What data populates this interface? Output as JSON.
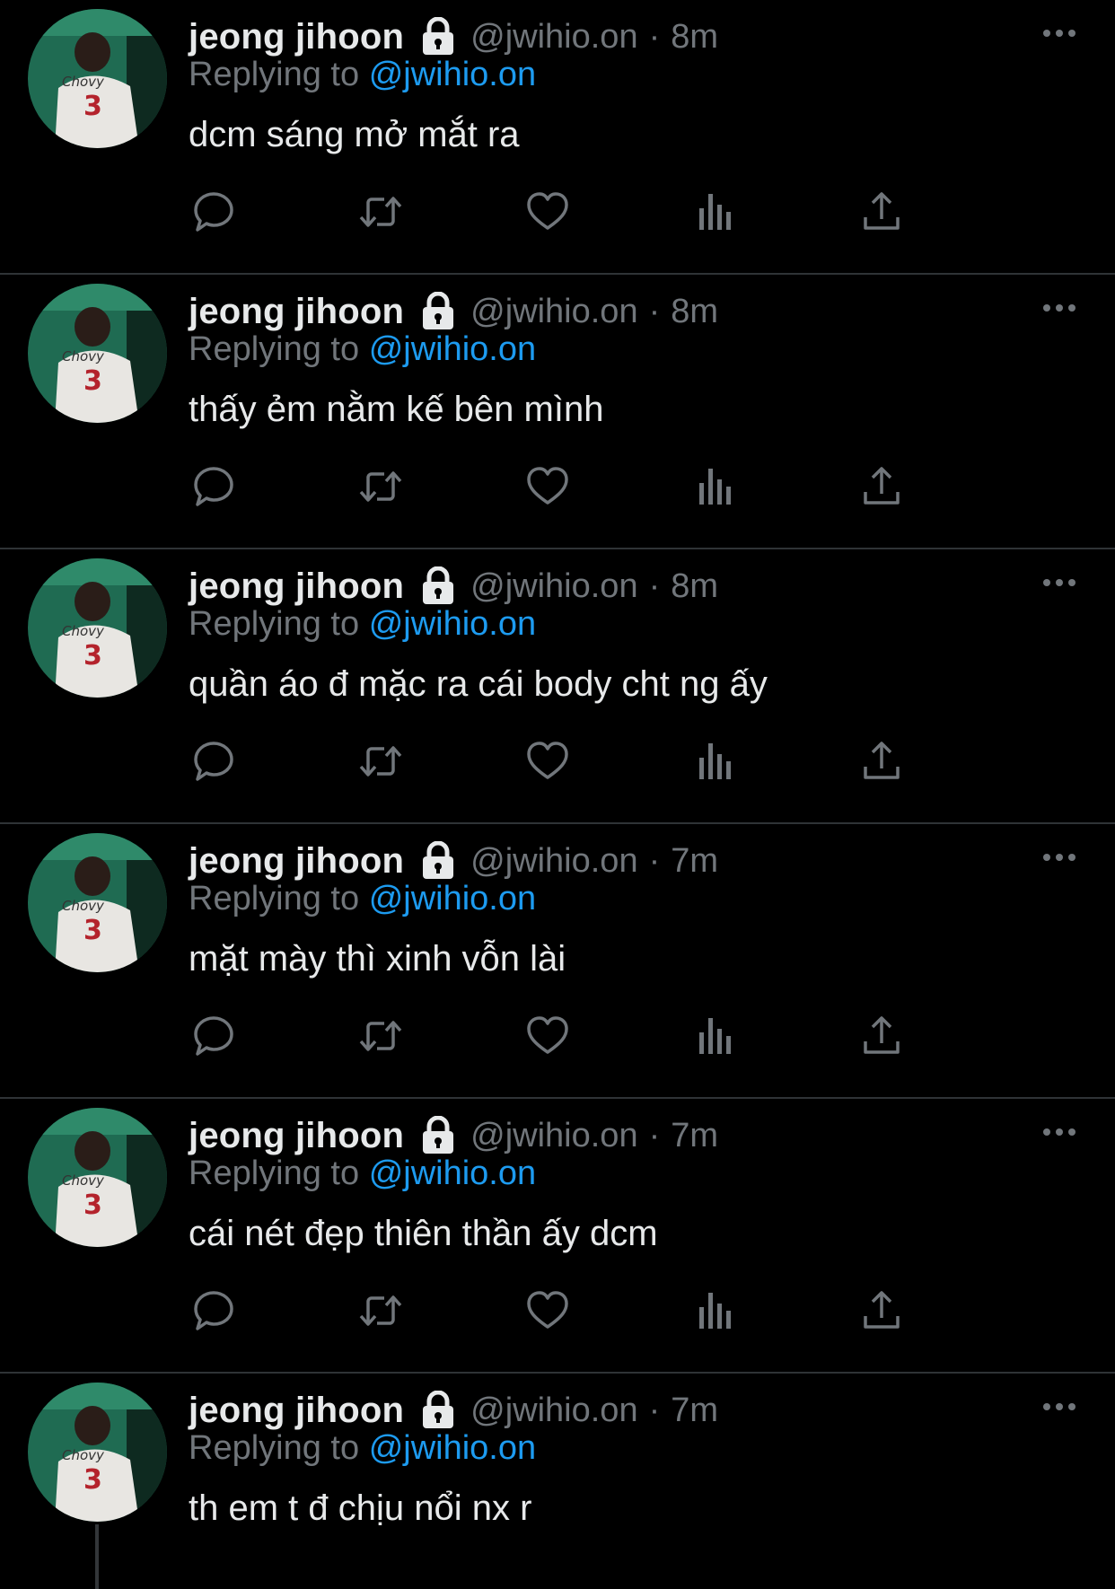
{
  "colors": {
    "background": "#000000",
    "primary_text": "#e7e9ea",
    "secondary_text": "#71767b",
    "link": "#1d9bf0",
    "divider": "#2f3336"
  },
  "icons": {
    "protected": "lock-icon",
    "reply": "reply-icon",
    "retweet": "retweet-icon",
    "like": "heart-icon",
    "views": "views-icon",
    "share": "share-icon",
    "more": "more-icon"
  },
  "tweets": [
    {
      "name": "jeong jihoon",
      "handle": "@jwihio.on",
      "separator": "·",
      "time": "8m",
      "replying_prefix": "Replying to",
      "replying_to": "@jwihio.on",
      "text": "dcm sáng mở mắt ra"
    },
    {
      "name": "jeong jihoon",
      "handle": "@jwihio.on",
      "separator": "·",
      "time": "8m",
      "replying_prefix": "Replying to",
      "replying_to": "@jwihio.on",
      "text": "thấy ẻm nằm kế bên mình"
    },
    {
      "name": "jeong jihoon",
      "handle": "@jwihio.on",
      "separator": "·",
      "time": "8m",
      "replying_prefix": "Replying to",
      "replying_to": "@jwihio.on",
      "text": "quần áo đ mặc ra cái body cht ng ấy"
    },
    {
      "name": "jeong jihoon",
      "handle": "@jwihio.on",
      "separator": "·",
      "time": "7m",
      "replying_prefix": "Replying to",
      "replying_to": "@jwihio.on",
      "text": "mặt mày thì xinh vỗn lài"
    },
    {
      "name": "jeong jihoon",
      "handle": "@jwihio.on",
      "separator": "·",
      "time": "7m",
      "replying_prefix": "Replying to",
      "replying_to": "@jwihio.on",
      "text": "cái nét đẹp thiên thần ấy dcm"
    },
    {
      "name": "jeong jihoon",
      "handle": "@jwihio.on",
      "separator": "·",
      "time": "7m",
      "replying_prefix": "Replying to",
      "replying_to": "@jwihio.on",
      "text": "th em t đ chịu nổi nx r"
    }
  ]
}
